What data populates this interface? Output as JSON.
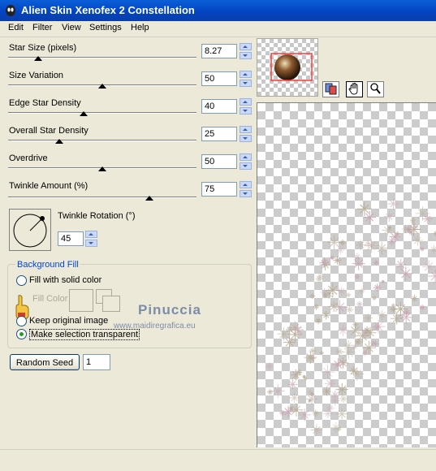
{
  "window": {
    "title": "Alien Skin Xenofex 2 Constellation"
  },
  "menu": [
    "Edit",
    "Filter",
    "View",
    "Settings",
    "Help"
  ],
  "sliders": [
    {
      "key": "star_size",
      "label": "Star Size (pixels)",
      "value": "8.27",
      "position": 0.16
    },
    {
      "key": "size_variation",
      "label": "Size Variation",
      "value": "50",
      "position": 0.5
    },
    {
      "key": "edge_star_density",
      "label": "Edge Star Density",
      "value": "40",
      "position": 0.4
    },
    {
      "key": "overall_star_density",
      "label": "Overall Star Density",
      "value": "25",
      "position": 0.27
    },
    {
      "key": "overdrive",
      "label": "Overdrive",
      "value": "50",
      "position": 0.5
    },
    {
      "key": "twinkle_amount",
      "label": "Twinkle Amount (%)",
      "value": "75",
      "position": 0.75
    }
  ],
  "twinkle_rotation": {
    "label": "Twinkle Rotation (°)",
    "value": "45"
  },
  "background_fill": {
    "title": "Background Fill",
    "options": [
      {
        "label": "Fill with solid color",
        "selected": false
      },
      {
        "label": "Keep original image",
        "selected": false
      },
      {
        "label": "Make selection transparent",
        "selected": true
      }
    ],
    "fill_color_label": "Fill Color"
  },
  "random_seed": {
    "label": "Random Seed",
    "value": "1"
  },
  "watermark": {
    "name": "Pinuccia",
    "url": "www.maidiregrafica.eu"
  },
  "colors": {
    "title_bar": "#0a5fd8",
    "accent_label": "#0046d5",
    "stars_pink": "#c9a5b3",
    "stars_tan": "#b8ab94"
  },
  "icons": [
    "app-icon",
    "preview-toggle-icon",
    "hand-tool-icon",
    "zoom-tool-icon"
  ]
}
